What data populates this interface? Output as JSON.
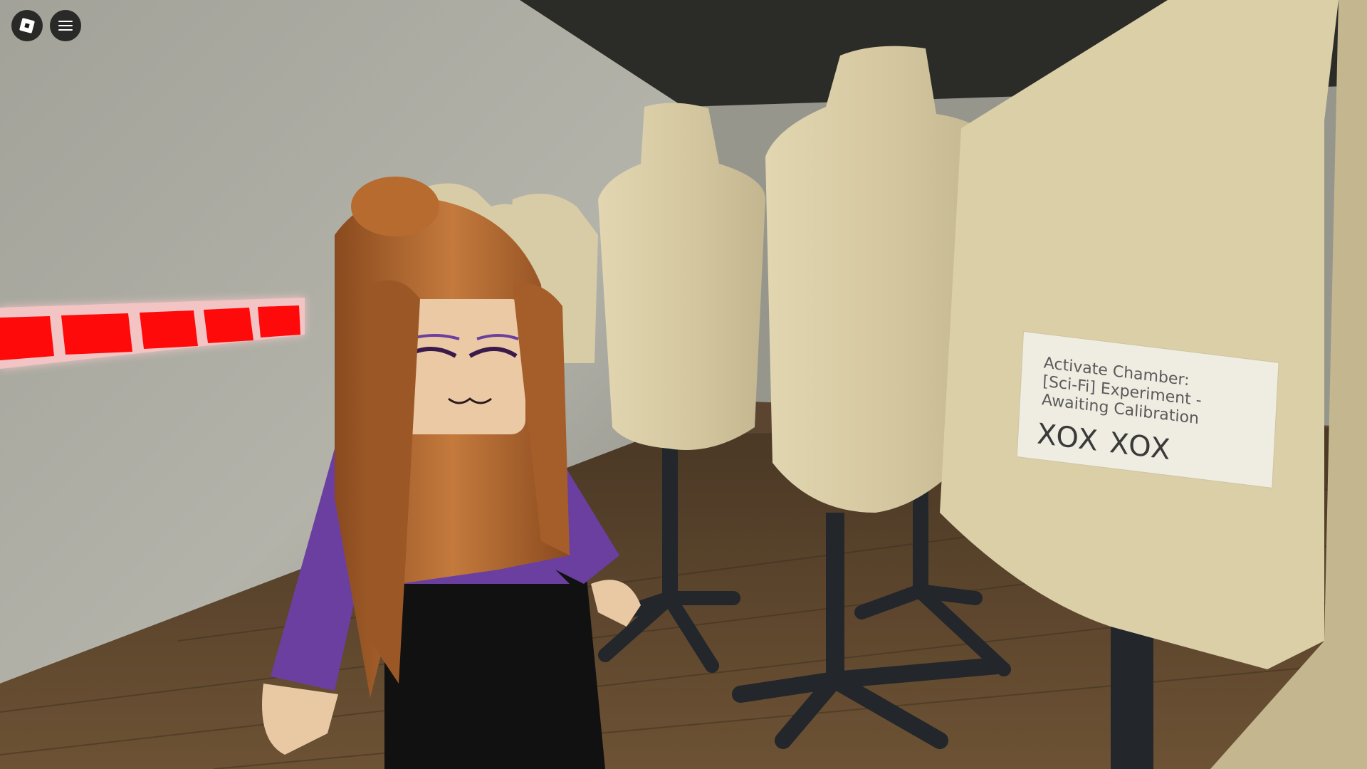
{
  "game": {
    "engine": "Roblox",
    "scene": "mannequin storage room"
  },
  "hud": {
    "logo_button": {
      "icon": "roblox-logo-icon"
    },
    "menu_button": {
      "icon": "hamburger-menu-icon"
    }
  },
  "world_sign": {
    "text": "Activate Chamber:\n[Sci-Fi] Experiment -\nAwaiting Calibration",
    "marks": "XOX  XOX"
  },
  "colors": {
    "wall": "#a8a89f",
    "ceiling": "#2b2b27",
    "floor": "#5c4630",
    "mannequin": "#d6c9a2",
    "mannequin_stand": "#23262b",
    "laser": "#ff0a0a",
    "shirt": "#6b3fa0",
    "hair": "#b4672e",
    "skin": "#e8c9a4"
  }
}
